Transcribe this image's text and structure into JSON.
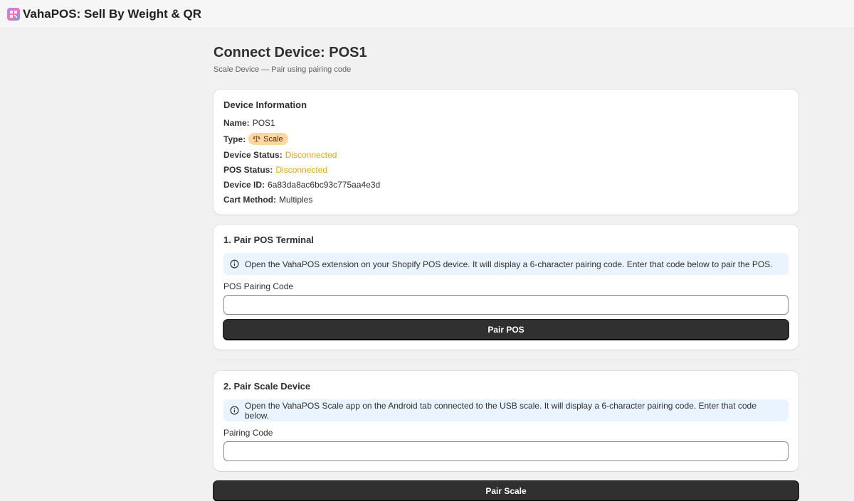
{
  "app": {
    "title": "VahaPOS: Sell By Weight & QR",
    "logo_icon": "app-logo-icon"
  },
  "header": {
    "title": "Connect Device: POS1",
    "subtitle": "Scale Device — Pair using pairing code"
  },
  "device_info": {
    "title": "Device Information",
    "rows": {
      "name": {
        "label": "Name:",
        "value": "POS1"
      },
      "type": {
        "label": "Type:",
        "value": "Scale",
        "icon": "scale-icon"
      },
      "device_status": {
        "label": "Device Status:",
        "value": "Disconnected"
      },
      "pos_status": {
        "label": "POS Status:",
        "value": "Disconnected"
      },
      "device_id": {
        "label": "Device ID:",
        "value": "6a83da8ac6bc93c775aa4e3d"
      },
      "cart_method": {
        "label": "Cart Method:",
        "value": "Multiples"
      }
    }
  },
  "pair_pos": {
    "title": "1. Pair POS Terminal",
    "banner": "Open the VahaPOS extension on your Shopify POS device. It will display a 6-character pairing code. Enter that code below to pair the POS.",
    "field_label": "POS Pairing Code",
    "field_value": "",
    "button_label": "Pair POS"
  },
  "pair_scale": {
    "title": "2. Pair Scale Device",
    "banner": "Open the VahaPOS Scale app on the Android tab connected to the USB scale. It will display a 6-character pairing code. Enter that code below.",
    "field_label": "Pairing Code",
    "field_value": "",
    "button_label": "Pair Scale"
  },
  "colors": {
    "background": "#f1f1f1",
    "card": "#ffffff",
    "warning_text": "#e5a319",
    "badge_bg": "#ffd6a4",
    "banner_bg": "#eaf4ff",
    "primary_button": "#303030"
  }
}
